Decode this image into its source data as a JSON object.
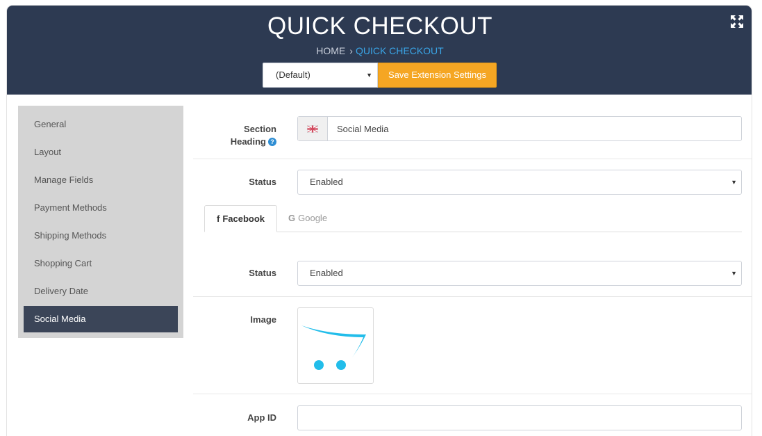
{
  "header": {
    "title": "QUICK CHECKOUT",
    "breadcrumb": {
      "home": "HOME",
      "separator": "›",
      "current": "QUICK CHECKOUT"
    },
    "store_select": {
      "value": "(Default)"
    },
    "save_button": "Save Extension Settings",
    "colors": {
      "background": "#2d3a52",
      "accent": "#f5a623",
      "link": "#3aa6e8"
    }
  },
  "sidebar": {
    "items": [
      {
        "label": "General"
      },
      {
        "label": "Layout"
      },
      {
        "label": "Manage Fields"
      },
      {
        "label": "Payment Methods"
      },
      {
        "label": "Shipping Methods"
      },
      {
        "label": "Shopping Cart"
      },
      {
        "label": "Delivery Date"
      },
      {
        "label": "Social Media",
        "active": true
      }
    ]
  },
  "form": {
    "section_heading": {
      "label_line1": "Section",
      "label_line2": "Heading",
      "help_icon": "?",
      "value": "Social Media"
    },
    "status": {
      "label": "Status",
      "value": "Enabled"
    },
    "tabs": [
      {
        "label": "Facebook",
        "icon": "f",
        "active": true
      },
      {
        "label": "Google",
        "icon": "G",
        "active": false
      }
    ],
    "facebook": {
      "status": {
        "label": "Status",
        "value": "Enabled"
      },
      "image": {
        "label": "Image"
      },
      "app_id": {
        "label": "App ID",
        "value": ""
      }
    }
  }
}
